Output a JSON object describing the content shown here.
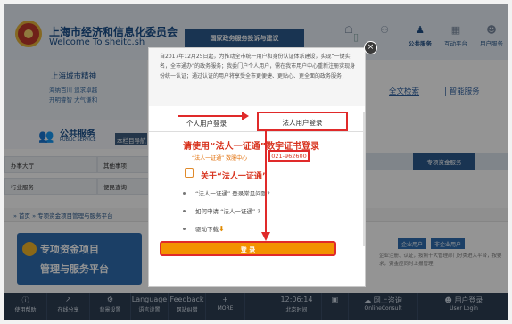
{
  "site": {
    "title": "上海市经济和信息化委员会",
    "subtitle": "Welcome To sheitc.sh",
    "gov_banner": "国家政务服务投诉与建议"
  },
  "topnav": [
    {
      "label": "",
      "icon": "chat-icon"
    },
    {
      "label": "",
      "icon": "people-icon"
    },
    {
      "label": "公共服务",
      "icon": "public-service-icon",
      "active": true
    },
    {
      "label": "互动平台",
      "icon": "grid-icon"
    },
    {
      "label": "用户服务",
      "icon": "user-icon"
    }
  ],
  "left_panel": {
    "spirit_title": "上海城市精神",
    "spirit_line1": "海纳百川 追求卓越",
    "spirit_line2": "开明睿智 大气谦和",
    "ps_title": "公共服务",
    "ps_sub": "PUBLIC SERVICE",
    "ps_tab": "本栏目导航"
  },
  "search": {
    "advanced": "全文检索",
    "smart": "智能服务"
  },
  "grid": {
    "row1": [
      "办事大厅",
      "其他事项"
    ],
    "row2": [
      "行业服务",
      "便民查询"
    ],
    "right_tab": "专项资金服务"
  },
  "breadcrumb": "» 首页 » 专项资金项目管理与服务平台",
  "promo": {
    "line1": "专项资金项目",
    "line2": "管理与服务平台"
  },
  "user_buttons": [
    "企业用户",
    "非企业用户"
  ],
  "right_text": "企业注册、认证，按照十大管理部门分类进入平台，按要求，资金应同时上报管理",
  "toolbar": [
    {
      "line1": "使用帮助",
      "icon": "info-icon"
    },
    {
      "line1": "在线分享",
      "icon": "share-icon"
    },
    {
      "line1": "背景设置",
      "icon": "gear-icon"
    },
    {
      "line1": "Language",
      "line2": "语言设置",
      "icon": ""
    },
    {
      "line1": "Feedback",
      "line2": "网站纠错",
      "icon": ""
    },
    {
      "line1": "MORE",
      "icon": "plus-icon"
    },
    {
      "line1": "12:06:14",
      "line2": "北京时间",
      "icon": ""
    },
    {
      "line1": "",
      "icon": "chat-icon"
    },
    {
      "line1": "网上咨询",
      "line2": "OnlineConsult",
      "icon": "chat-bubble-icon"
    },
    {
      "line1": "用户登录",
      "line2": "User Login",
      "icon": "user-icon"
    }
  ],
  "modal": {
    "notice": "自2017年12月25日起，为推动全市统一用户和身份认证体系建设，实现“一键实名，全市通办”的政务服务；我委门户个人用户，需在我市用户中心重新注册实现身份统一认证；通过认证的用户将享受全市更便捷、更贴心、更全面的政务服务；",
    "tab_personal": "个人用户登录",
    "tab_legal": "法人用户登录",
    "heading": "请使用“法人一证通”数字证书登录",
    "hotline_label": "“法人一证通” 数服中心",
    "hotline_number": "021-962600",
    "about_title": "关于“法人一证通”",
    "faqs": [
      "“法人一证通” 登录常见问题?",
      "如何申请 “法人一证通” ?",
      "驱动下载"
    ],
    "login_button": "登 录",
    "close": "×"
  },
  "colors": {
    "accent": "#f39200",
    "annotation": "#e02a2a",
    "brand": "#2b5a8e"
  }
}
